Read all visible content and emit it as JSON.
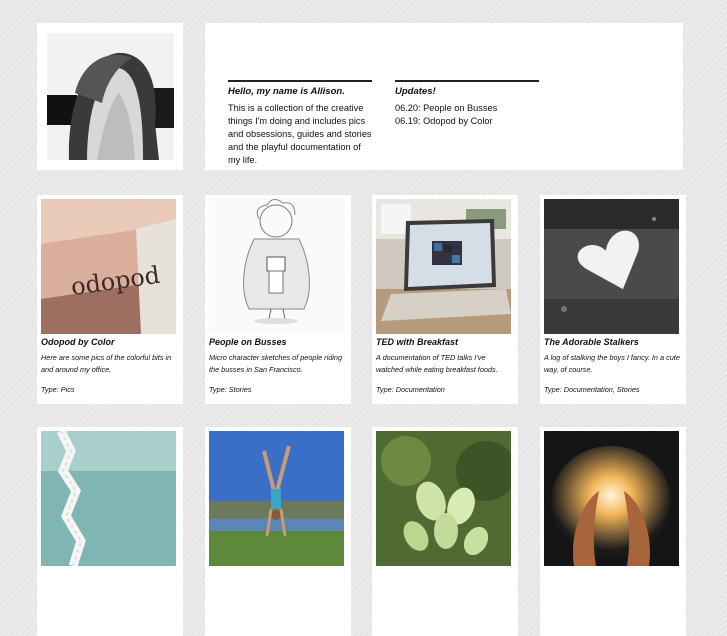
{
  "intro": {
    "heading": "Hello, my name is Allison.",
    "body": "This is a collection of the creative things I'm doing and includes pics and obsessions, guides and stories and the playful documentation of my life."
  },
  "updates": {
    "heading": "Updates!",
    "items": [
      "06.20: People on Busses",
      "06.19: Odopod by Color"
    ]
  },
  "projects": [
    {
      "title": "Odopod by Color",
      "desc": "Here are some pics of the colorful bits in and around my office.",
      "type": "Type: Pics",
      "sign_text": "odopod"
    },
    {
      "title": "People on Busses",
      "desc": "Micro character sketches of people riding the busses in San Francisco.",
      "type": "Type: Stories"
    },
    {
      "title": "TED with Breakfast",
      "desc": "A documentation of TED talks I've watched while eating breakfast foods.",
      "type": "Type: Documentation"
    },
    {
      "title": "The Adorable Stalkers",
      "desc": "A log of stalking the boys I fancy. In a cute way, of course.",
      "type": "Type: Documentation, Stories"
    }
  ],
  "colors": {
    "background": "#e6e6e6",
    "card": "#ffffff",
    "text": "#111111",
    "rule": "#222222"
  },
  "icons": [
    "avatar-photo",
    "odopod-sign-photo",
    "bus-sketch",
    "laptop-photo",
    "heart-photo",
    "paper-chain-photo",
    "handstand-photo",
    "flower-photo",
    "glowing-hands-photo"
  ]
}
